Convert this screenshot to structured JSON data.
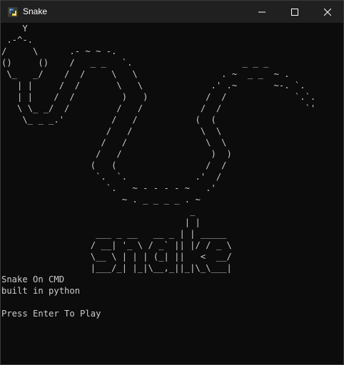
{
  "window": {
    "title": "Snake",
    "icon": "python-icon",
    "controls": [
      "minimize-icon",
      "maximize-icon",
      "close-icon"
    ]
  },
  "console": {
    "ascii_art": "    Y\n .-^-.\n/     \\      .- ~ ~ -.\n()     ()    /   _ _   `.                     _ _ _\n \\_   _/    /  /     \\   \\                . ~  _ _  ~ .\n   | |     /  /       \\   \\             .' .~       ~-. `.\n   | |    /  /         )   )           /  /             `.`.\n   \\ \\_ _/  /         /   /           /  /                `'\n    \\_ _ _.'         /   /           (  (\n                    /   /             \\  \\\n                   /   /               \\  \\\n                  /   /                 )  )\n                 (   (                 /  /\n                  `.  `.             .'  /\n                    `.   ~ - - - - ~   .'\n                       ~ . _ _ _ _ . ~\n                                    _\n                                   | |\n                  ___ _ __   __ _ | | _____\n                 / __| '_ \\ / _` || |/ / _ \\\n                 \\__ \\ | | | (_| ||   <  __/\n                 |___/_| |_|\\__,_||_|\\_\\___|",
    "info_line1": "Snake On CMD",
    "info_line2": "built in python",
    "prompt": "Press Enter To Play"
  },
  "colors": {
    "background": "#0c0c0c",
    "titlebar": "#202020",
    "text": "#cccccc"
  }
}
